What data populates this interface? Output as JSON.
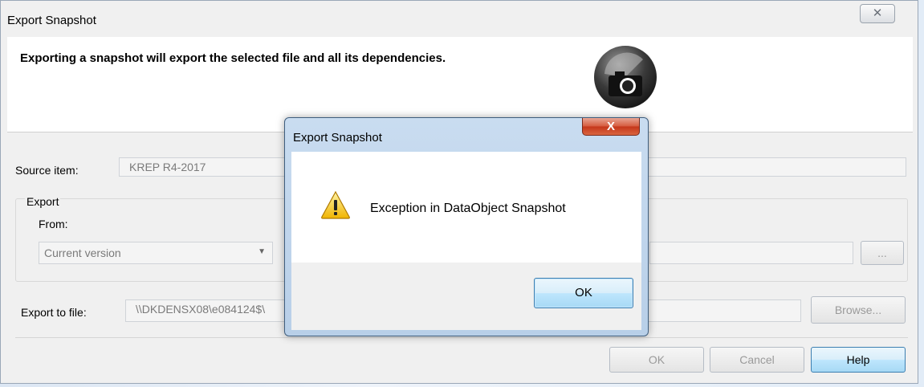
{
  "main_dialog": {
    "title": "Export Snapshot",
    "close_glyph": "✕",
    "header_text": "Exporting a snapshot will export the selected file and all its dependencies.",
    "header_icon": "camera-icon",
    "source_label": "Source item:",
    "source_value": "KREP R4-2017",
    "export_group_label": "Export",
    "from_label": "From:",
    "from_value": "Current version",
    "ellipsis_label": "...",
    "export_file_label": "Export to file:",
    "export_file_value": "\\\\DKDENSX08\\e084124$\\",
    "browse_label": "Browse...",
    "ok_label": "OK",
    "cancel_label": "Cancel",
    "help_label": "Help"
  },
  "modal": {
    "title": "Export Snapshot",
    "close_glyph": "X",
    "icon": "warning-icon",
    "message": "Exception in DataObject Snapshot",
    "ok_label": "OK"
  }
}
